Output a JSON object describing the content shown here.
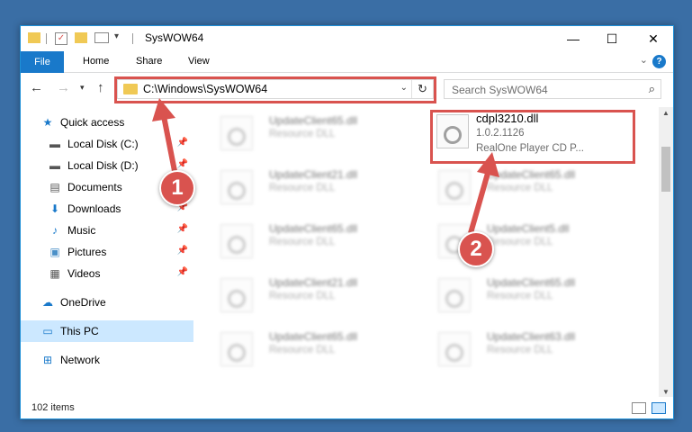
{
  "window": {
    "title": "SysWOW64"
  },
  "ribbon": {
    "tabs": [
      "File",
      "Home",
      "Share",
      "View"
    ]
  },
  "address": {
    "path": "C:\\Windows\\SysWOW64"
  },
  "search": {
    "placeholder": "Search SysWOW64"
  },
  "nav": {
    "items": [
      {
        "label": "Quick access",
        "icon": "star-icon"
      },
      {
        "label": "Local Disk (C:)",
        "icon": "drive-icon"
      },
      {
        "label": "Local Disk (D:)",
        "icon": "drive-icon"
      },
      {
        "label": "Documents",
        "icon": "documents-icon"
      },
      {
        "label": "Downloads",
        "icon": "download-icon"
      },
      {
        "label": "Music",
        "icon": "music-icon"
      },
      {
        "label": "Pictures",
        "icon": "pictures-icon"
      },
      {
        "label": "Videos",
        "icon": "videos-icon"
      },
      {
        "label": "OneDrive",
        "icon": "cloud-icon"
      },
      {
        "label": "This PC",
        "icon": "computer-icon"
      },
      {
        "label": "Network",
        "icon": "network-icon"
      }
    ]
  },
  "files": {
    "left": [
      {
        "name": "UpdateClient65.dll",
        "type": "Resource DLL"
      },
      {
        "name": "UpdateClient21.dll",
        "type": "Resource DLL"
      },
      {
        "name": "UpdateClient65.dll",
        "type": "Resource DLL"
      },
      {
        "name": "UpdateClient21.dll",
        "type": "Resource DLL"
      },
      {
        "name": "UpdateClient65.dll",
        "type": "Resource DLL"
      }
    ],
    "highlighted": {
      "name": "cdpl3210.dll",
      "version": "1.0.2.1126",
      "description": "RealOne Player CD P..."
    },
    "right": [
      {
        "name": "UpdateClient65.dll",
        "type": "Resource DLL"
      },
      {
        "name": "UpdateClient5.dll",
        "type": "Resource DLL"
      },
      {
        "name": "UpdateClient65.dll",
        "type": "Resource DLL"
      },
      {
        "name": "UpdateClient63.dll",
        "type": "Resource DLL"
      }
    ]
  },
  "status": {
    "items": "102 items"
  },
  "callouts": {
    "one": "1",
    "two": "2"
  },
  "colors": {
    "accent": "#1979ca",
    "highlight": "#d9534f",
    "selected": "#cce8ff"
  }
}
